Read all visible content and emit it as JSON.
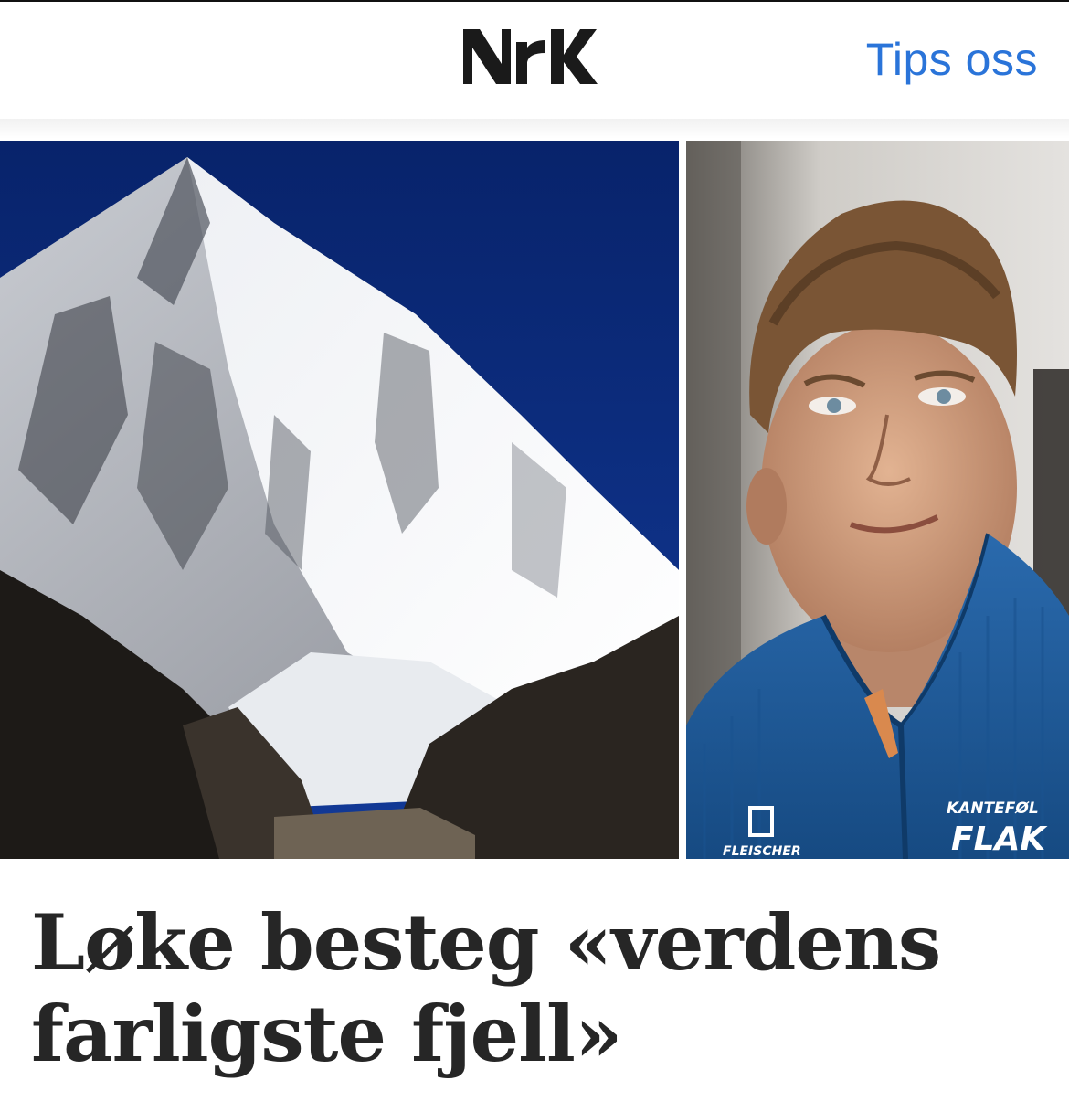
{
  "header": {
    "logo_text": "NRK",
    "tips_link": "Tips oss"
  },
  "images": {
    "mountain": "mountain-photo",
    "person": "portrait-photo"
  },
  "jacket": {
    "brand_line1": "KANTEFØL",
    "brand_line2": "FLAK",
    "sponsor": "FLEISCHER"
  },
  "article": {
    "headline": "Løke besteg «verdens farligste fjell»"
  },
  "colors": {
    "link": "#2a74d9",
    "headline": "#262626",
    "sky": "#0c2a7a",
    "jacket": "#1f5a98"
  }
}
